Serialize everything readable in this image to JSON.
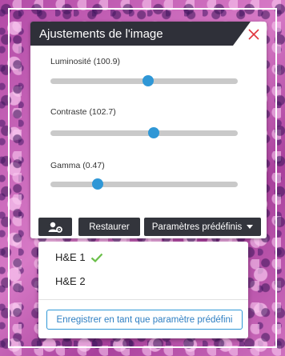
{
  "panel": {
    "title": "Ajustements de l'image",
    "close_icon": "close-icon"
  },
  "sliders": [
    {
      "label": "Luminosité (100.9)",
      "value": 100.9,
      "fraction": 0.52
    },
    {
      "label": "Contraste (102.7)",
      "value": 102.7,
      "fraction": 0.55
    },
    {
      "label": "Gamma (0.47)",
      "value": 0.47,
      "fraction": 0.25
    }
  ],
  "toolbar": {
    "user_settings_icon": "user-gear-icon",
    "restore_label": "Restaurer",
    "presets_label": "Paramètres prédéfinis"
  },
  "presets": {
    "items": [
      {
        "label": "H&E 1",
        "selected": true
      },
      {
        "label": "H&E 2",
        "selected": false
      }
    ],
    "save_label": "Enregistrer en tant que paramètre prédéfini"
  },
  "colors": {
    "header": "#2f3039",
    "accent": "#2f97d6",
    "close": "#e0343c",
    "check": "#6bbf4a"
  }
}
